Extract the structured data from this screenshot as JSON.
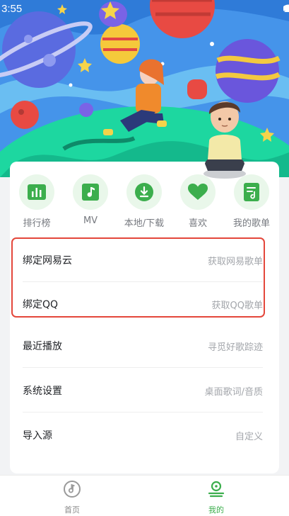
{
  "status_bar": {
    "time": "3:55",
    "icons": [
      "signal-icon",
      "wifi-icon",
      "battery-icon"
    ]
  },
  "quick_actions": [
    {
      "label": "排行榜",
      "icon": "chart-bars-icon"
    },
    {
      "label": "MV",
      "icon": "music-note-icon"
    },
    {
      "label": "本地/下载",
      "icon": "download-icon"
    },
    {
      "label": "喜欢",
      "icon": "heart-icon"
    },
    {
      "label": "我的歌单",
      "icon": "playlist-icon"
    }
  ],
  "menu": [
    {
      "title": "绑定网易云",
      "hint": "获取网易歌单"
    },
    {
      "title": "绑定QQ",
      "hint": "获取QQ歌单"
    },
    {
      "title": "最近播放",
      "hint": "寻觅好歌踪迹"
    },
    {
      "title": "系统设置",
      "hint": "桌面歌词/音质"
    },
    {
      "title": "导入源",
      "hint": "自定义"
    }
  ],
  "bottom_nav": [
    {
      "label": "首页",
      "icon": "disc-icon",
      "active": false
    },
    {
      "label": "我的",
      "icon": "user-icon",
      "active": true
    }
  ],
  "colors": {
    "accent": "#3cae4d",
    "icon_circle_bg": "#e9f7ea",
    "highlight_border": "#e4473b",
    "inactive_nav": "#9a9a9a"
  }
}
